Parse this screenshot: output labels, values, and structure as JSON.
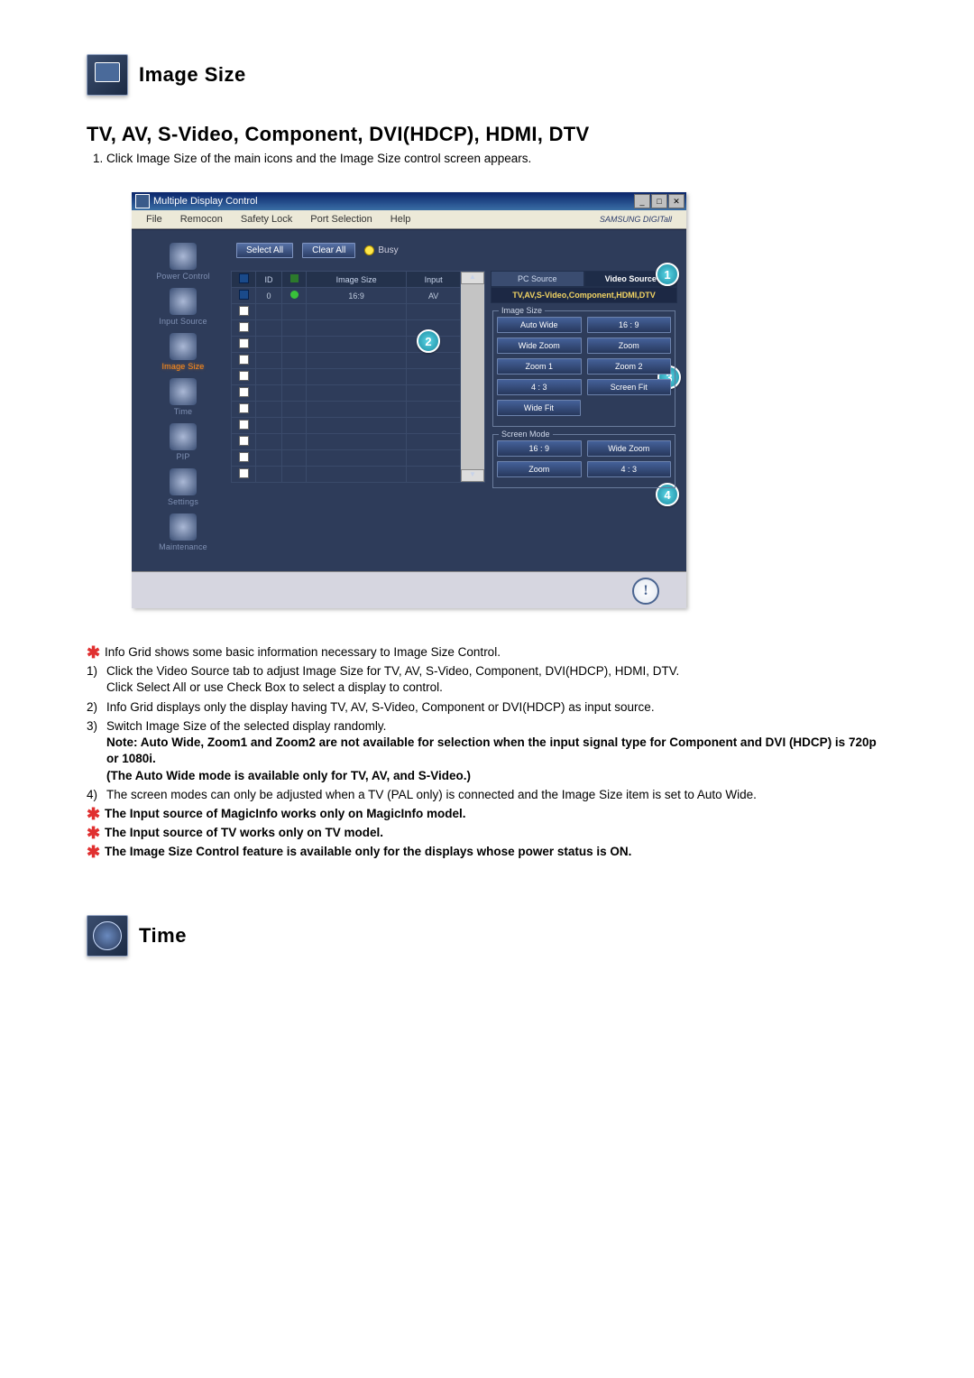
{
  "section1_title": "Image Size",
  "subtitle": "TV, AV, S-Video, Component, DVI(HDCP), HDMI, DTV",
  "intro_step": "Click Image Size of the main icons and the Image Size control screen appears.",
  "window": {
    "title": "Multiple Display Control",
    "menu": {
      "file": "File",
      "remocon": "Remocon",
      "safety": "Safety Lock",
      "port": "Port Selection",
      "help": "Help",
      "brand": "SAMSUNG DIGITall"
    },
    "topbar": {
      "select_all": "Select All",
      "clear_all": "Clear All",
      "busy": "Busy"
    },
    "sidebar": {
      "power": "Power Control",
      "input": "Input Source",
      "image": "Image Size",
      "time": "Time",
      "pip": "PIP",
      "settings": "Settings",
      "maint": "Maintenance"
    },
    "grid": {
      "h_id": "ID",
      "h_size": "Image Size",
      "h_input": "Input",
      "row_id": "0",
      "row_size": "16:9",
      "row_input": "AV"
    },
    "tabs": {
      "pc": "PC Source",
      "video": "Video Source"
    },
    "panel_sub": "TV,AV,S-Video,Component,HDMI,DTV",
    "fs1_legend": "Image Size",
    "fs1_btns": {
      "autowide": "Auto Wide",
      "r169": "16 : 9",
      "widezoom": "Wide Zoom",
      "zoom": "Zoom",
      "zoom1": "Zoom 1",
      "zoom2": "Zoom 2",
      "r43": "4 : 3",
      "screenfit": "Screen Fit",
      "widefit": "Wide Fit"
    },
    "fs2_legend": "Screen Mode",
    "fs2_btns": {
      "r169": "16 : 9",
      "widezoom": "Wide Zoom",
      "zoom": "Zoom",
      "r43": "4 : 3"
    }
  },
  "info": {
    "line1": "Info Grid shows some basic information necessary to Image Size Control.",
    "n1a": "Click the Video Source tab to adjust Image Size for TV, AV, S-Video, Component, DVI(HDCP), HDMI, DTV.",
    "n1b": "Click Select All or use Check Box to select a display to control.",
    "n2": "Info Grid displays only the display having TV, AV, S-Video, Component or DVI(HDCP) as input source.",
    "n3a": "Switch Image Size of the selected display randomly.",
    "n3b_label": "Note:",
    "n3b": " Auto Wide, Zoom1 and Zoom2 are not available for selection when the input signal type for Component and DVI (HDCP) is 720p or 1080i.",
    "n3c": "(The Auto Wide mode is available only for TV, AV, and S-Video.)",
    "n4": "The screen modes can only be adjusted when a TV (PAL only) is connected and the Image Size item is set to Auto Wide.",
    "star1": "The Input source of MagicInfo works only on MagicInfo model.",
    "star2": "The Input source of TV works only on TV model.",
    "star3": "The Image Size Control feature is available only for the displays whose power status is ON."
  },
  "section2_title": "Time"
}
